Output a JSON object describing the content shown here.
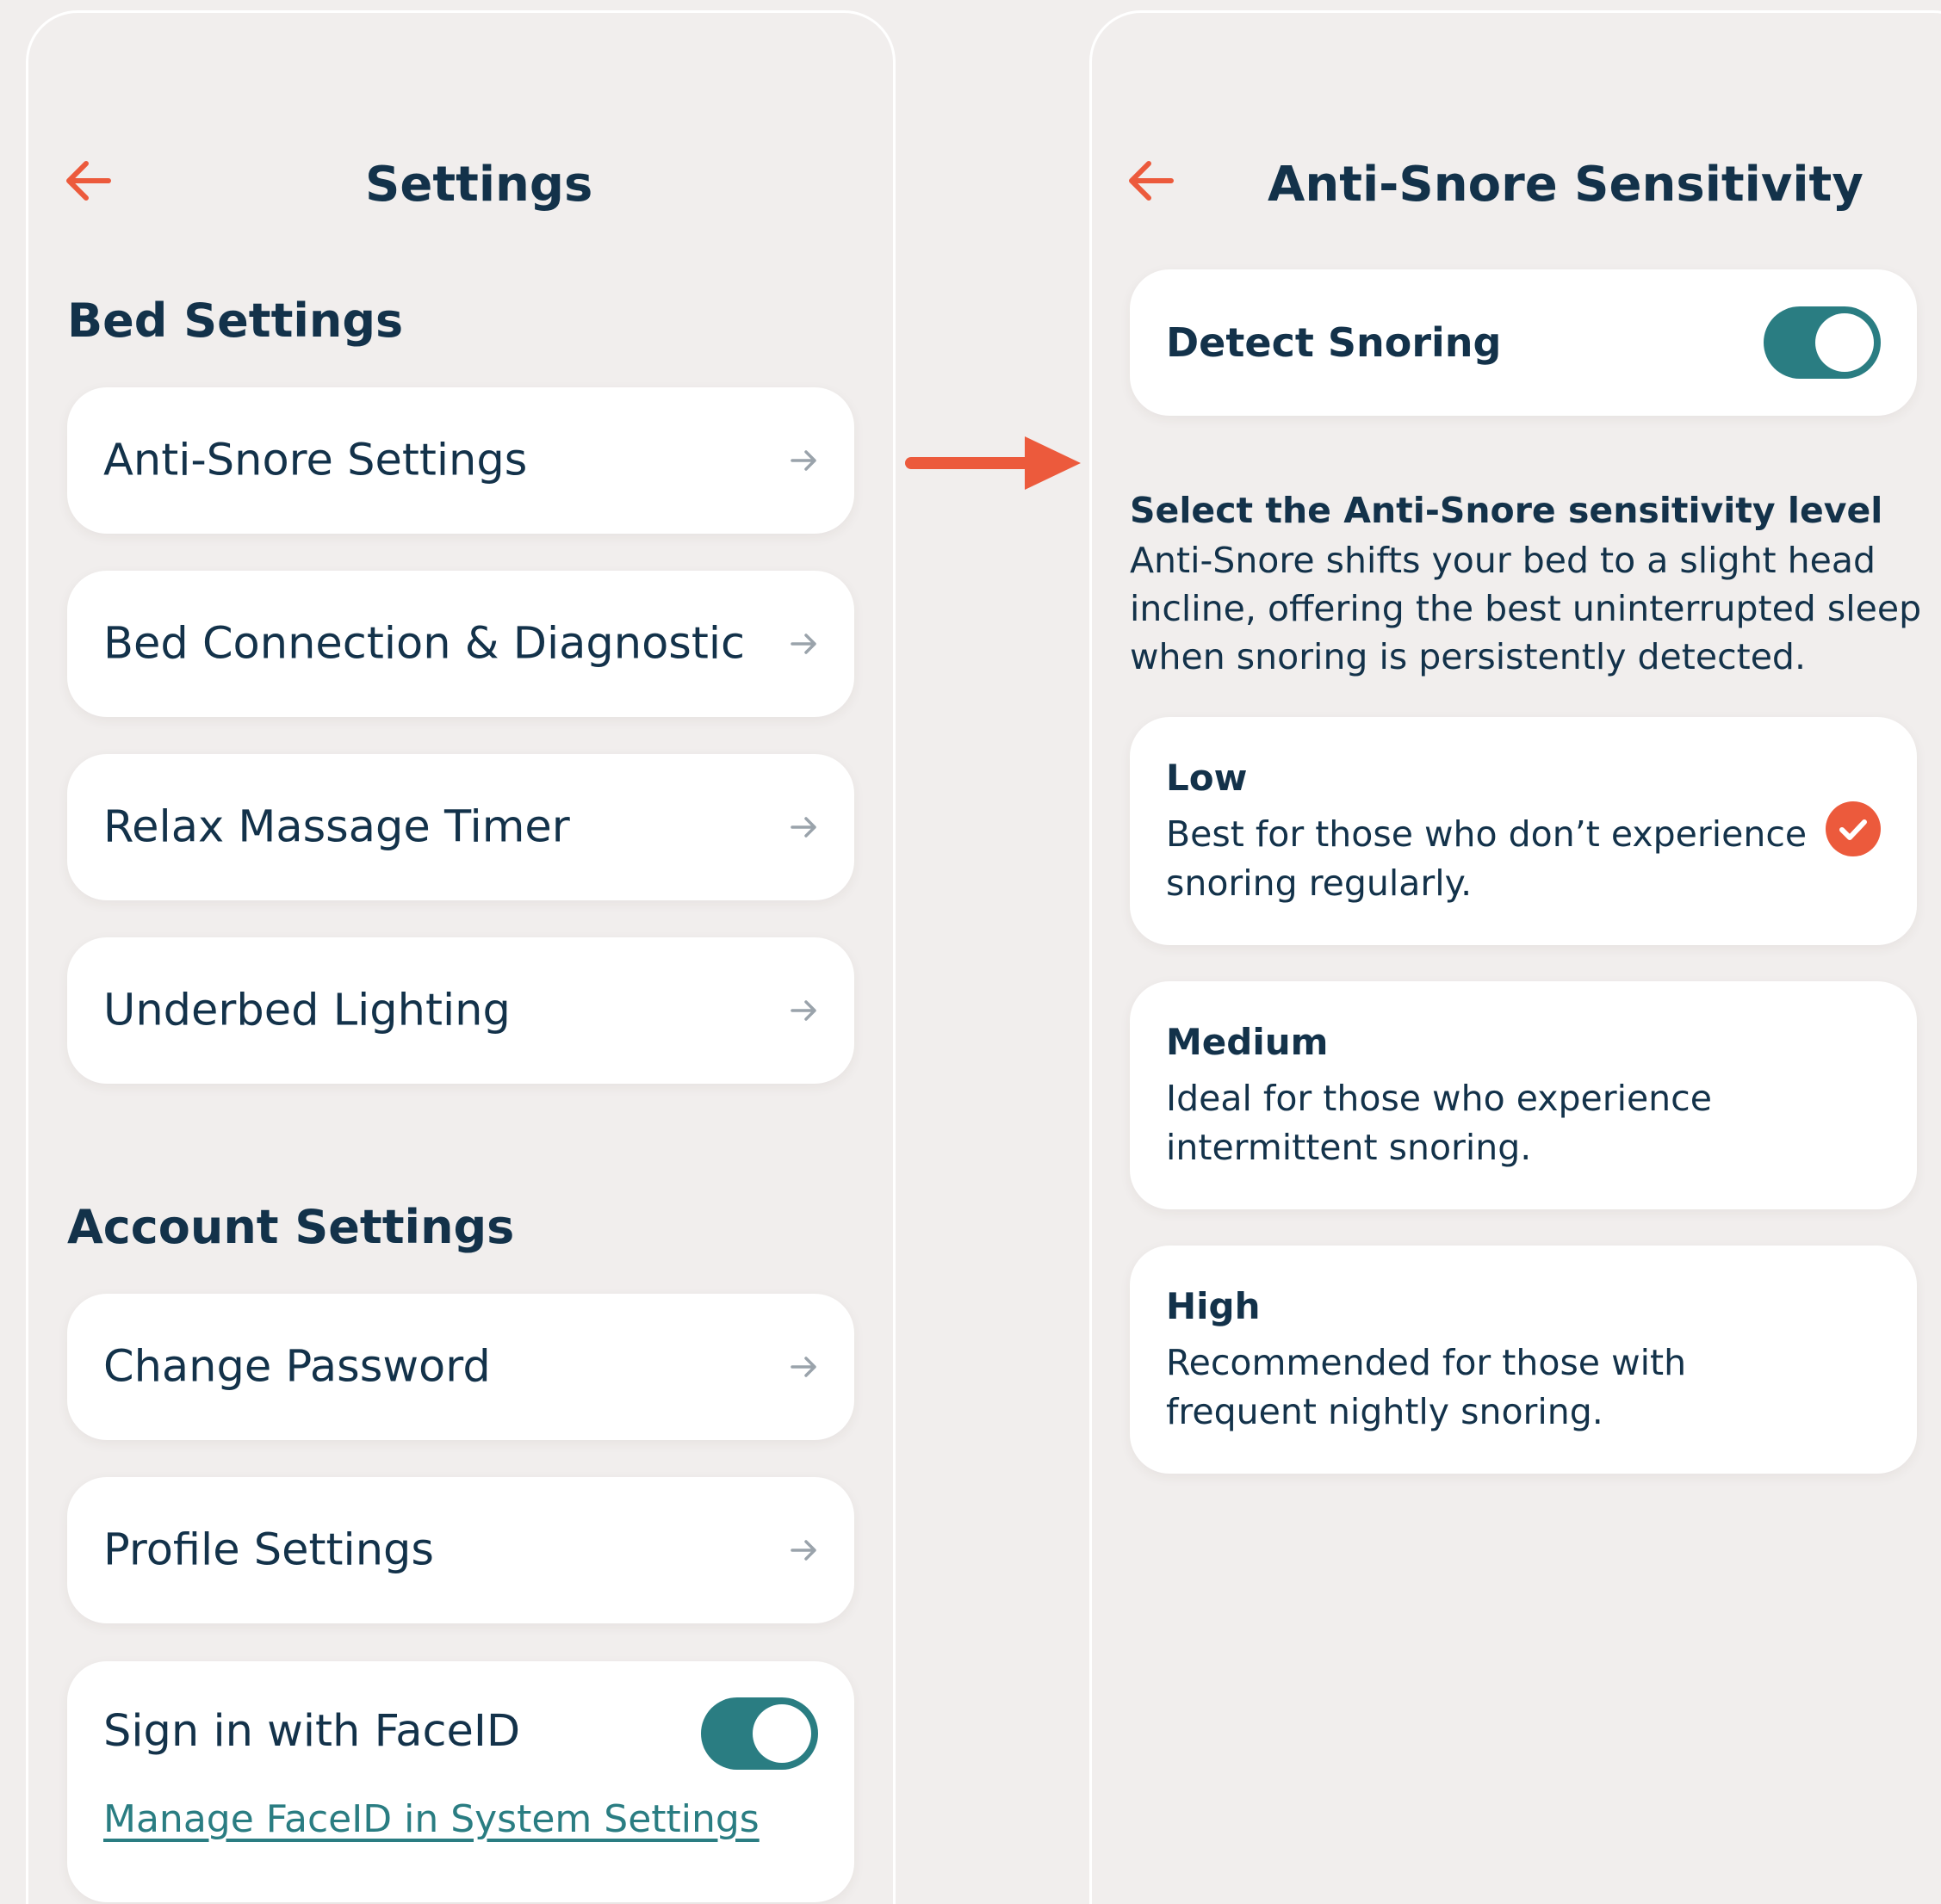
{
  "colors": {
    "accent": "#ec5a3c",
    "toggle_on": "#2a7d82",
    "text": "#13324a",
    "background": "#f1eeed",
    "card": "#ffffff",
    "chevron": "#9aa3ab"
  },
  "left_screen": {
    "title": "Settings",
    "back_icon": "arrow-left-icon",
    "bed_section": {
      "heading": "Bed Settings",
      "items": [
        {
          "label": "Anti-Snore Settings"
        },
        {
          "label": "Bed Connection & Diagnostic"
        },
        {
          "label": "Relax Massage Timer"
        },
        {
          "label": "Underbed Lighting"
        }
      ]
    },
    "account_section": {
      "heading": "Account Settings",
      "items": [
        {
          "label": "Change Password"
        },
        {
          "label": "Profile Settings"
        }
      ],
      "faceid": {
        "label": "Sign in with FaceID",
        "enabled": true,
        "link": "Manage FaceID in System Settings"
      }
    }
  },
  "transition_arrow_icon": "arrow-right-icon",
  "right_screen": {
    "title": "Anti-Snore Sensitivity",
    "back_icon": "arrow-left-icon",
    "detect": {
      "label": "Detect Snoring",
      "enabled": true
    },
    "intro_heading": "Select the Anti-Snore sensitivity level",
    "intro_text": "Anti-Snore shifts your bed to a slight head incline, offering the best uninterrupted sleep when snoring is persistently detected.",
    "options": [
      {
        "title": "Low",
        "desc": "Best for those who don’t experience snoring regularly.",
        "selected": true
      },
      {
        "title": "Medium",
        "desc": "Ideal for those who experience intermittent snoring.",
        "selected": false
      },
      {
        "title": "High",
        "desc": "Recommended for those with frequent nightly snoring.",
        "selected": false
      }
    ]
  }
}
